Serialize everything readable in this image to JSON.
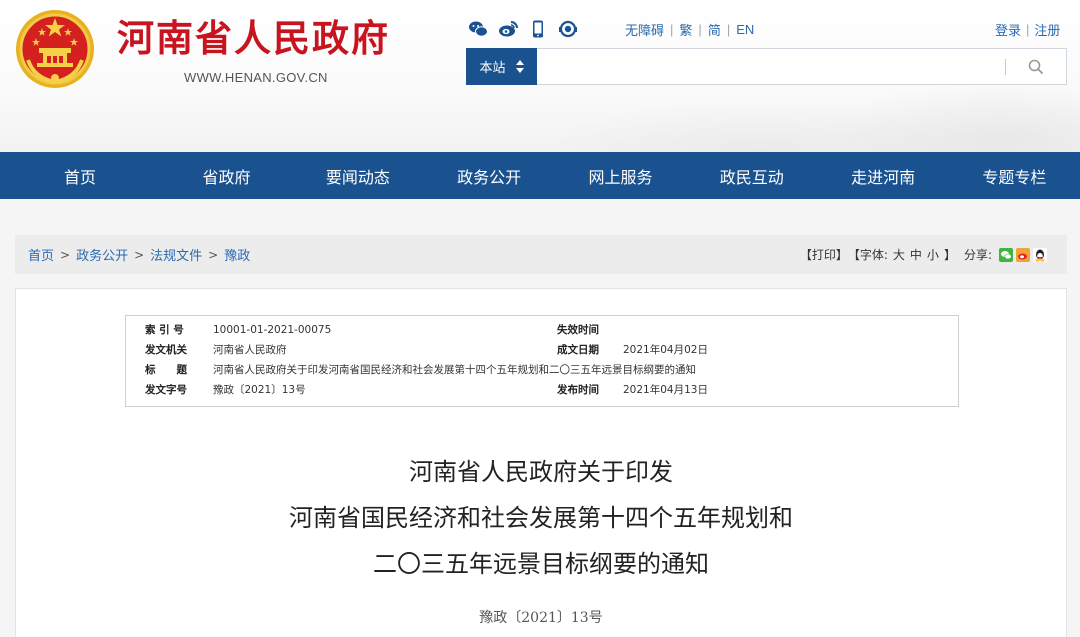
{
  "header": {
    "site_name": "河南省人民政府",
    "site_url": "WWW.HENAN.GOV.CN",
    "social_icons": [
      "wechat-icon",
      "weibo-icon",
      "mobile-icon",
      "app-icon"
    ],
    "top_links": [
      "无障碍",
      "繁",
      "简",
      "EN"
    ],
    "user_links": [
      "登录",
      "注册"
    ],
    "search": {
      "scope_label": "本站",
      "placeholder": "",
      "value": ""
    }
  },
  "nav": {
    "items": [
      "首页",
      "省政府",
      "要闻动态",
      "政务公开",
      "网上服务",
      "政民互动",
      "走进河南",
      "专题专栏"
    ]
  },
  "breadcrumb": {
    "items": [
      "首页",
      "政务公开",
      "法规文件",
      "豫政"
    ],
    "separator": ">"
  },
  "tools": {
    "print": "【打印】",
    "font_open": "【字体:",
    "font_large": "大",
    "font_medium": "中",
    "font_small": "小",
    "font_close": "】",
    "share_label": "分享:",
    "share_icons": [
      "wechat-share-icon",
      "weibo-share-icon",
      "qq-share-icon"
    ]
  },
  "meta": {
    "index_label": "索 引 号",
    "index_value": "10001-01-2021-00075",
    "expire_label": "失效时间",
    "expire_value": "",
    "issuer_label": "发文机关",
    "issuer_value": "河南省人民政府",
    "written_label": "成文日期",
    "written_value": "2021年04月02日",
    "title_label": "标　　题",
    "title_value": "河南省人民政府关于印发河南省国民经济和社会发展第十四个五年规划和二〇三五年远景目标纲要的通知",
    "docno_label": "发文字号",
    "docno_value": "豫政〔2021〕13号",
    "publish_label": "发布时间",
    "publish_value": "2021年04月13日"
  },
  "document": {
    "title_line1": "河南省人民政府关于印发",
    "title_line2": "河南省国民经济和社会发展第十四个五年规划和",
    "title_line3": "二〇三五年远景目标纲要的通知",
    "number": "豫政〔2021〕13号"
  },
  "colors": {
    "brand_red": "#c8141e",
    "nav_blue": "#1a5290",
    "link_blue": "#2a6ab0"
  }
}
